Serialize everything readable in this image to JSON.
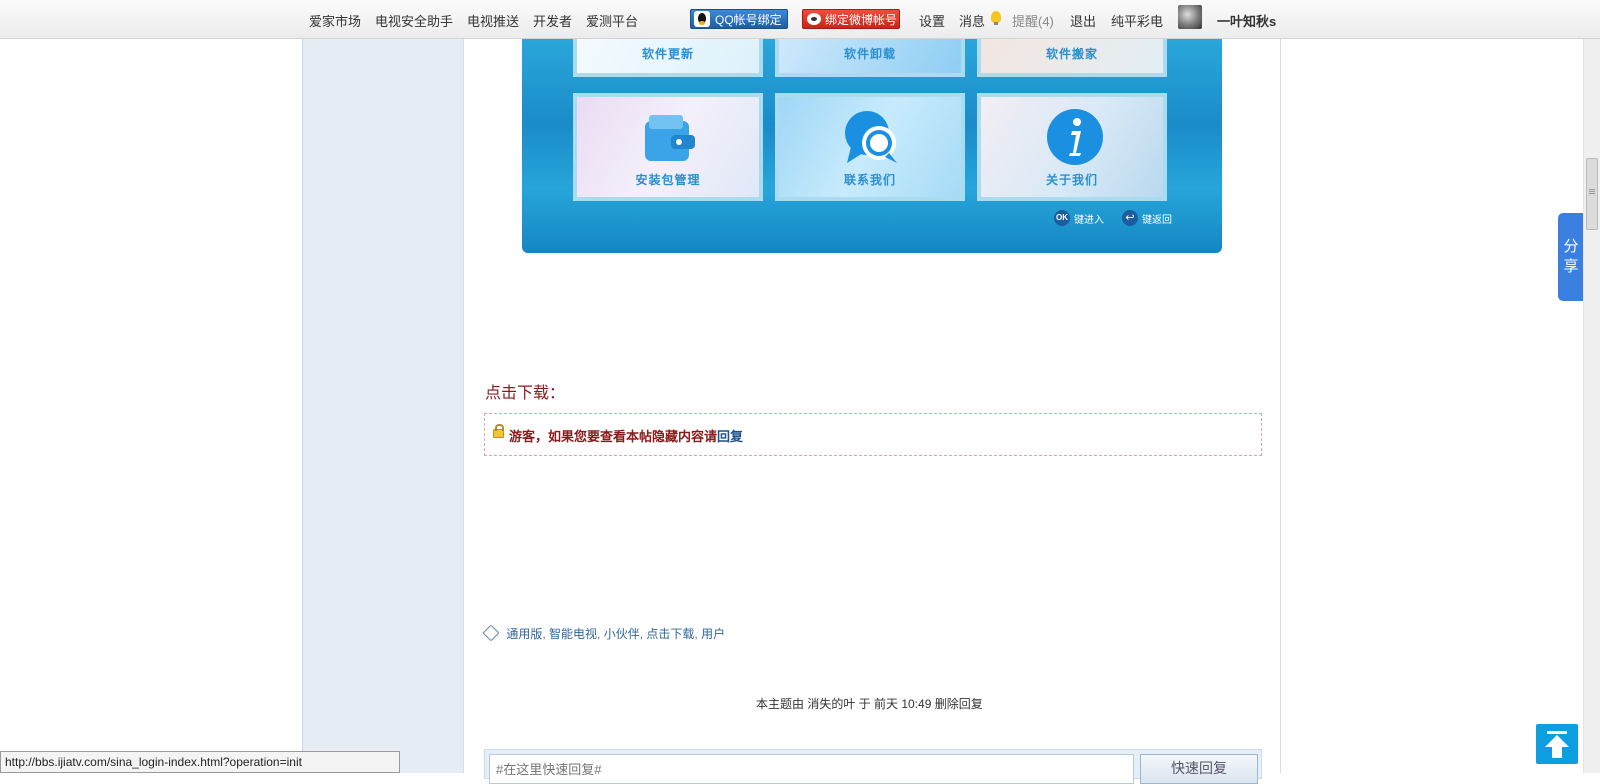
{
  "topnav": {
    "items": [
      "爱家市场",
      "电视安全助手",
      "电视推送",
      "开发者",
      "爱测平台"
    ],
    "qq_bind": "QQ帐号绑定",
    "weibo_bind": "绑定微博帐号",
    "settings": "设置",
    "messages": "消息",
    "reminders": "提醒(4)",
    "logout": "退出",
    "username_link": "纯平彩电",
    "username": "一叶知秋s"
  },
  "tv_menu": {
    "top_row": [
      "软件更新",
      "软件卸载",
      "软件搬家"
    ],
    "bottom_row": [
      "安装包管理",
      "联系我们",
      "关于我们"
    ],
    "ok_hint_icon": "OK",
    "ok_hint": "键进入",
    "back_hint": "键返回"
  },
  "post": {
    "download_heading": "点击下载：",
    "hidden_notice": "游客，如果您要查看本帖隐藏内容请",
    "hidden_reply_link": "回复",
    "tags": [
      "通用版",
      "智能电视",
      "小伙伴",
      "点击下载",
      "用户"
    ],
    "topic_line": "本主题由 消失的叶 于 前天 10:49 删除回复"
  },
  "quick_reply": {
    "placeholder": "#在这里快速回复#",
    "button": "快速回复"
  },
  "share_tab": [
    "分",
    "享"
  ],
  "status_url": "http://bbs.ijiatv.com/sina_login-index.html?operation=init"
}
